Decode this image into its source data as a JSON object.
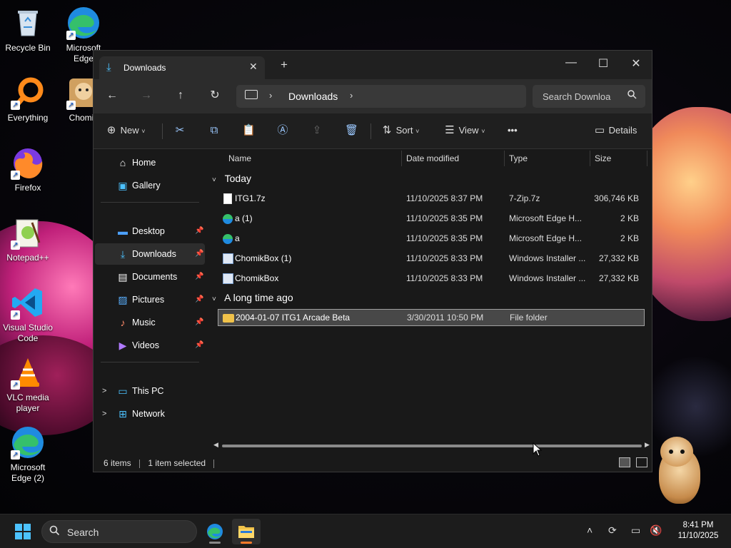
{
  "desktop": {
    "icons": [
      {
        "label": "Recycle Bin"
      },
      {
        "label": "Microsoft Edge"
      },
      {
        "label": "Everything"
      },
      {
        "label": "Chomik"
      },
      {
        "label": "Firefox"
      },
      {
        "label": "Notepad++"
      },
      {
        "label": "Visual Studio Code"
      },
      {
        "label": "VLC media player"
      },
      {
        "label": "Microsoft Edge (2)"
      }
    ]
  },
  "window": {
    "tab_title": "Downloads",
    "tab_close": "✕",
    "new_tab": "+",
    "controls": {
      "minimize": "—",
      "maximize": "☐",
      "close": "✕"
    },
    "address": {
      "crumb": "Downloads",
      "chevron": "›"
    },
    "search": {
      "placeholder": "Search Downloa"
    }
  },
  "toolbar": {
    "new_label": "New",
    "sort_label": "Sort",
    "view_label": "View",
    "more_label": "•••",
    "details_label": "Details"
  },
  "nav_pane": {
    "items": [
      {
        "label": "Home",
        "icon": "home-icon"
      },
      {
        "label": "Gallery",
        "icon": "gallery-icon"
      },
      {
        "label": "Desktop",
        "icon": "desktop-icon",
        "pinned": true
      },
      {
        "label": "Downloads",
        "icon": "downloads-icon",
        "pinned": true,
        "selected": true
      },
      {
        "label": "Documents",
        "icon": "documents-icon",
        "pinned": true
      },
      {
        "label": "Pictures",
        "icon": "pictures-icon",
        "pinned": true
      },
      {
        "label": "Music",
        "icon": "music-icon",
        "pinned": true
      },
      {
        "label": "Videos",
        "icon": "videos-icon",
        "pinned": true
      },
      {
        "label": "This PC",
        "icon": "this-pc-icon"
      },
      {
        "label": "Network",
        "icon": "network-icon"
      }
    ]
  },
  "file_list": {
    "columns": [
      "Name",
      "Date modified",
      "Type",
      "Size"
    ],
    "groups": [
      {
        "label": "Today",
        "rows": [
          {
            "name": "ITG1.7z",
            "date": "11/10/2025 8:37 PM",
            "type": "7-Zip.7z",
            "size": "306,746 KB",
            "icon": "file-icon"
          },
          {
            "name": "a (1)",
            "date": "11/10/2025 8:35 PM",
            "type": "Microsoft Edge H...",
            "size": "2 KB",
            "icon": "edge-icon"
          },
          {
            "name": "a",
            "date": "11/10/2025 8:35 PM",
            "type": "Microsoft Edge H...",
            "size": "2 KB",
            "icon": "edge-icon"
          },
          {
            "name": "ChomikBox (1)",
            "date": "11/10/2025 8:33 PM",
            "type": "Windows Installer ...",
            "size": "27,332 KB",
            "icon": "installer-icon"
          },
          {
            "name": "ChomikBox",
            "date": "11/10/2025 8:33 PM",
            "type": "Windows Installer ...",
            "size": "27,332 KB",
            "icon": "installer-icon"
          }
        ]
      },
      {
        "label": "A long time ago",
        "rows": [
          {
            "name": "2004-01-07 ITG1 Arcade Beta",
            "date": "3/30/2011 10:50 PM",
            "type": "File folder",
            "size": "",
            "icon": "folder-icon",
            "selected": true
          }
        ]
      }
    ]
  },
  "status": {
    "items": "6 items",
    "selected": "1 item selected"
  },
  "taskbar": {
    "search_label": "Search",
    "time": "8:41 PM",
    "date": "11/10/2025"
  },
  "colors": {
    "accent": "#4cc2ff",
    "window_bg": "#191919",
    "selection": "#484848"
  }
}
